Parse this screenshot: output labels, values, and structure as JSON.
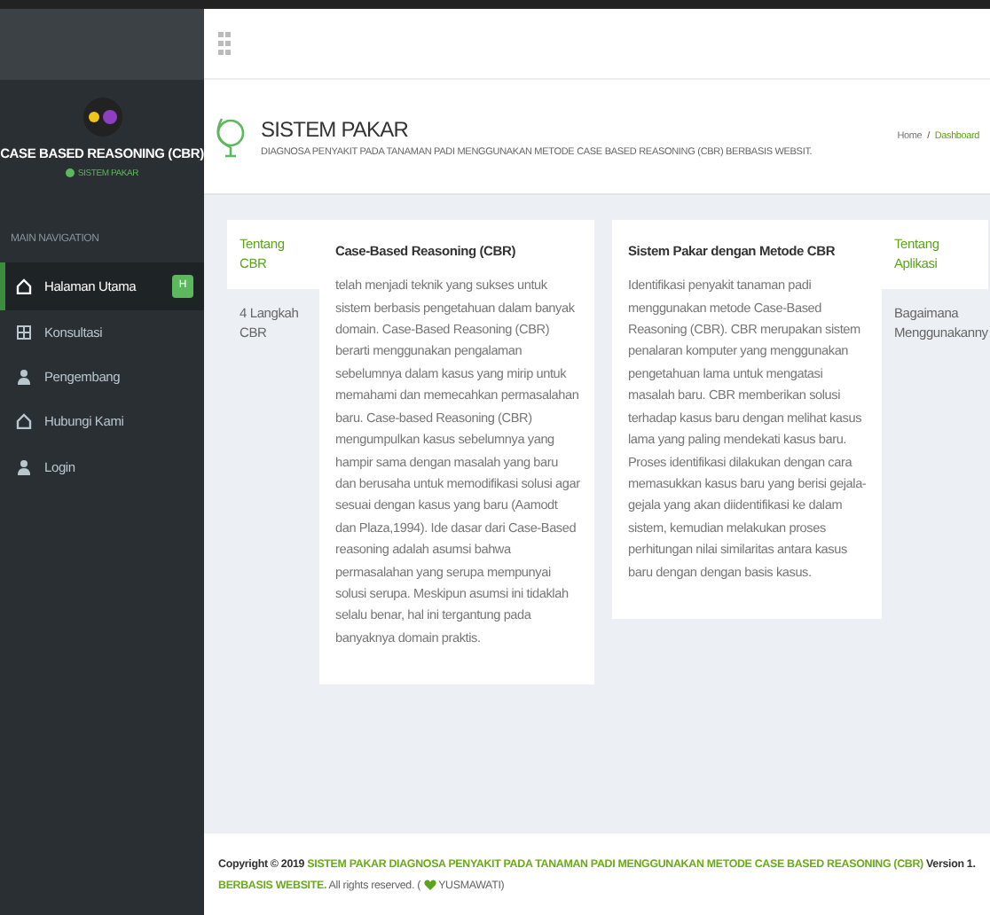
{
  "sidebar": {
    "brand": "CASE BASED REASONING (CBR)",
    "status": "SISTEM PAKAR",
    "section": "MAIN NAVIGATION",
    "items": [
      {
        "label": "Halaman Utama",
        "selected": true,
        "badge": "H"
      },
      {
        "label": "Konsultasi",
        "selected": false
      },
      {
        "label": "Pengembang",
        "selected": false
      },
      {
        "label": "Hubungi Kami",
        "selected": false
      },
      {
        "label": "Login",
        "selected": false
      }
    ]
  },
  "header": {
    "title": "SISTEM PAKAR",
    "subtitle": "DIAGNOSA PENYAKIT PADA TANAMAN PADI MENGGUNAKAN METODE CASE BASED REASONING (CBR) BERBASIS WEBSIT.",
    "breadcrumb": [
      {
        "label": "Home",
        "selected": false
      },
      {
        "label": "Dashboard",
        "selected": true
      }
    ],
    "breadcrumb_separator": "/"
  },
  "panels": [
    {
      "tabs": [
        {
          "label": "Tentang CBR",
          "selected": true
        },
        {
          "label": "4 Langkah CBR",
          "selected": false
        }
      ],
      "heading": "Case-Based Reasoning (CBR)",
      "body": "telah menjadi teknik yang sukses untuk sistem berbasis pengetahuan dalam banyak domain. Case-Based Reasoning (CBR) berarti menggunakan pengalaman sebelumnya dalam kasus yang mirip untuk memahami dan memecahkan permasalahan baru. Case-based Reasoning (CBR) mengumpulkan kasus sebelumnya yang hampir sama dengan masalah yang baru dan berusaha untuk memodifikasi solusi agar sesuai dengan kasus yang baru (Aamodt dan Plaza,1994). Ide dasar dari Case-Based reasoning adalah asumsi bahwa permasalahan yang serupa mempunyai solusi serupa. Meskipun asumsi ini tidaklah selalu benar, hal ini tergantung pada banyaknya domain praktis."
    },
    {
      "tabs": [
        {
          "label": "Tentang Aplikasi",
          "selected": true
        },
        {
          "label": "Bagaimana Menggunakanny",
          "selected": false
        }
      ],
      "heading": "Sistem Pakar dengan Metode CBR",
      "body": "Identifikasi penyakit tanaman padi menggunakan metode Case-Based Reasoning (CBR). CBR merupakan sistem penalaran komputer yang menggunakan pengetahuan lama untuk mengatasi masalah baru. CBR memberikan solusi terhadap kasus baru dengan melihat kasus lama yang paling mendekati kasus baru. Proses identifikasi dilakukan dengan cara memasukkan kasus baru yang berisi gejala-gejala yang akan diidentifikasi ke dalam sistem, kemudian melakukan proses perhitungan nilai similaritas antara kasus baru dengan dengan basis kasus."
    }
  ],
  "footer": [
    {
      "kind": "strong",
      "text": "Copyright © 2019"
    },
    {
      "kind": "link",
      "text": "SISTEM PAKAR DIAGNOSA PENYAKIT PADA TANAMAN PADI MENGGUNAKAN METODE CASE BASED REASONING (CBR)"
    },
    {
      "kind": "strong",
      "text": "Version 1."
    },
    {
      "kind": "link",
      "text": "BERBASIS WEBSITE."
    },
    {
      "kind": "text",
      "text": "All rights reserved. ("
    },
    {
      "kind": "heart"
    },
    {
      "kind": "text",
      "text": "YUSMAWATI)"
    }
  ]
}
